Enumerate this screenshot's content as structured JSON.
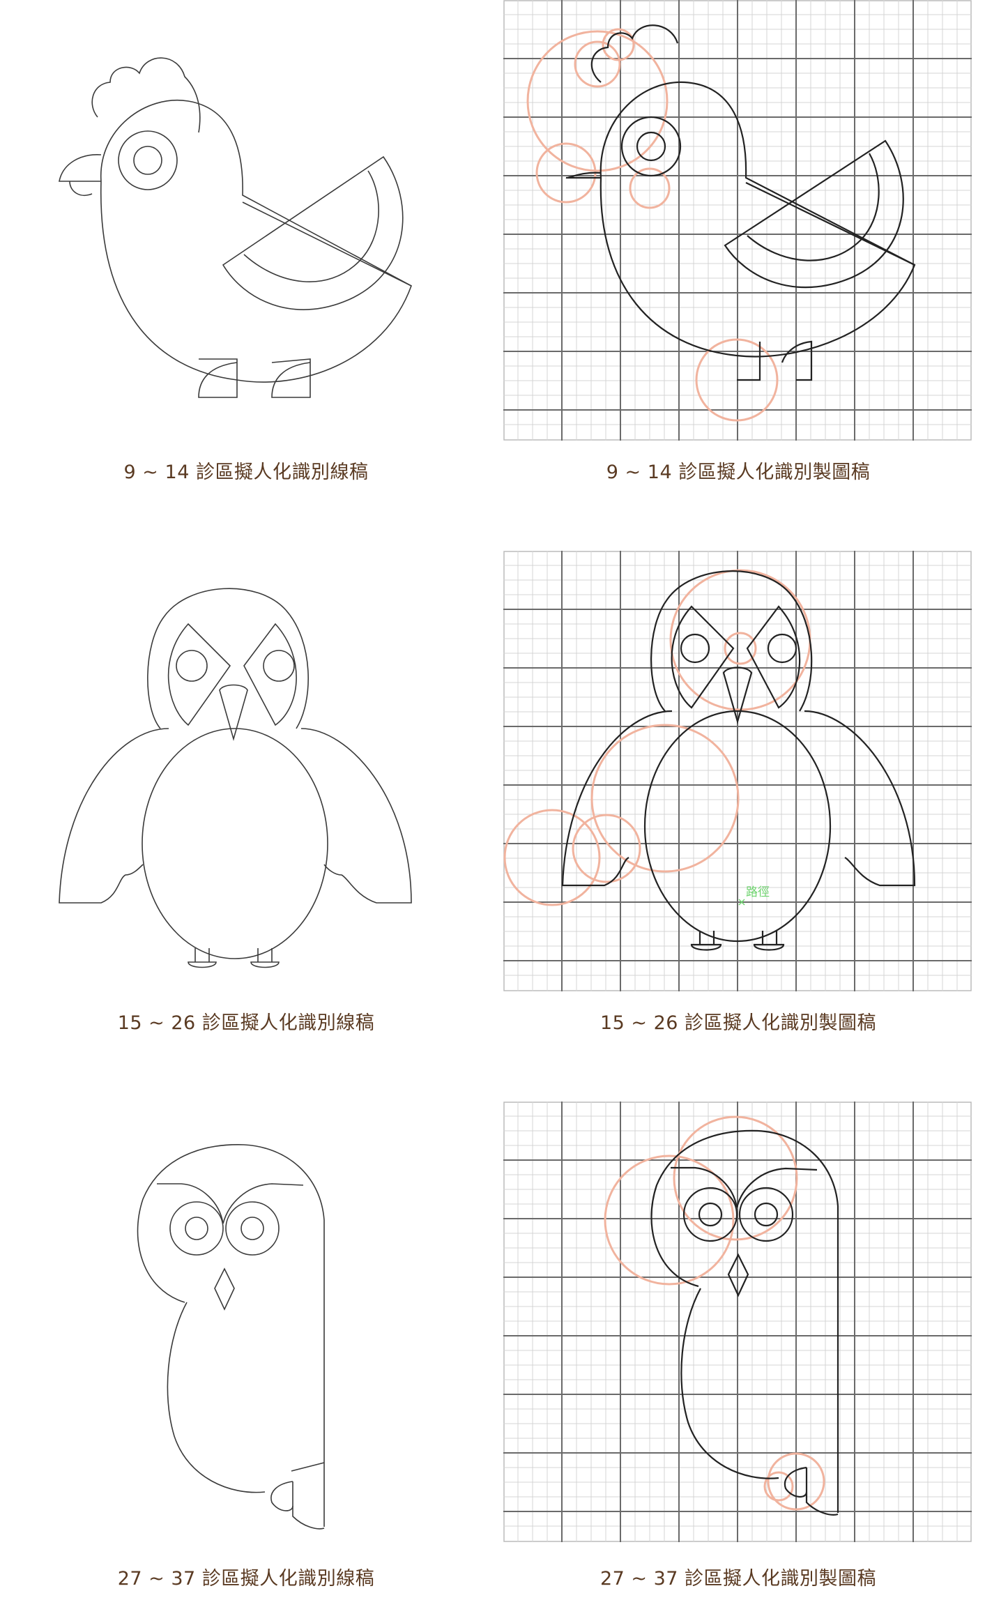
{
  "rows": [
    {
      "line_caption": "9 ~ 14 診區擬人化識別線稿",
      "grid_caption": "9 ~ 14 診區擬人化識別製圖稿"
    },
    {
      "line_caption": "15 ~ 26 診區擬人化識別線稿",
      "grid_caption": "15 ~ 26 診區擬人化識別製圖稿",
      "path_label": "路徑"
    },
    {
      "line_caption": "27 ~ 37 診區擬人化識別線稿",
      "grid_caption": "27 ~ 37 診區擬人化識別製圖稿"
    }
  ],
  "colors": {
    "caption": "#5a3a22",
    "guide_circle": "#f1b39e",
    "grid_major": "#6a6a6a",
    "grid_minor": "#d4d4d4",
    "path_marker": "#6dd36d"
  }
}
